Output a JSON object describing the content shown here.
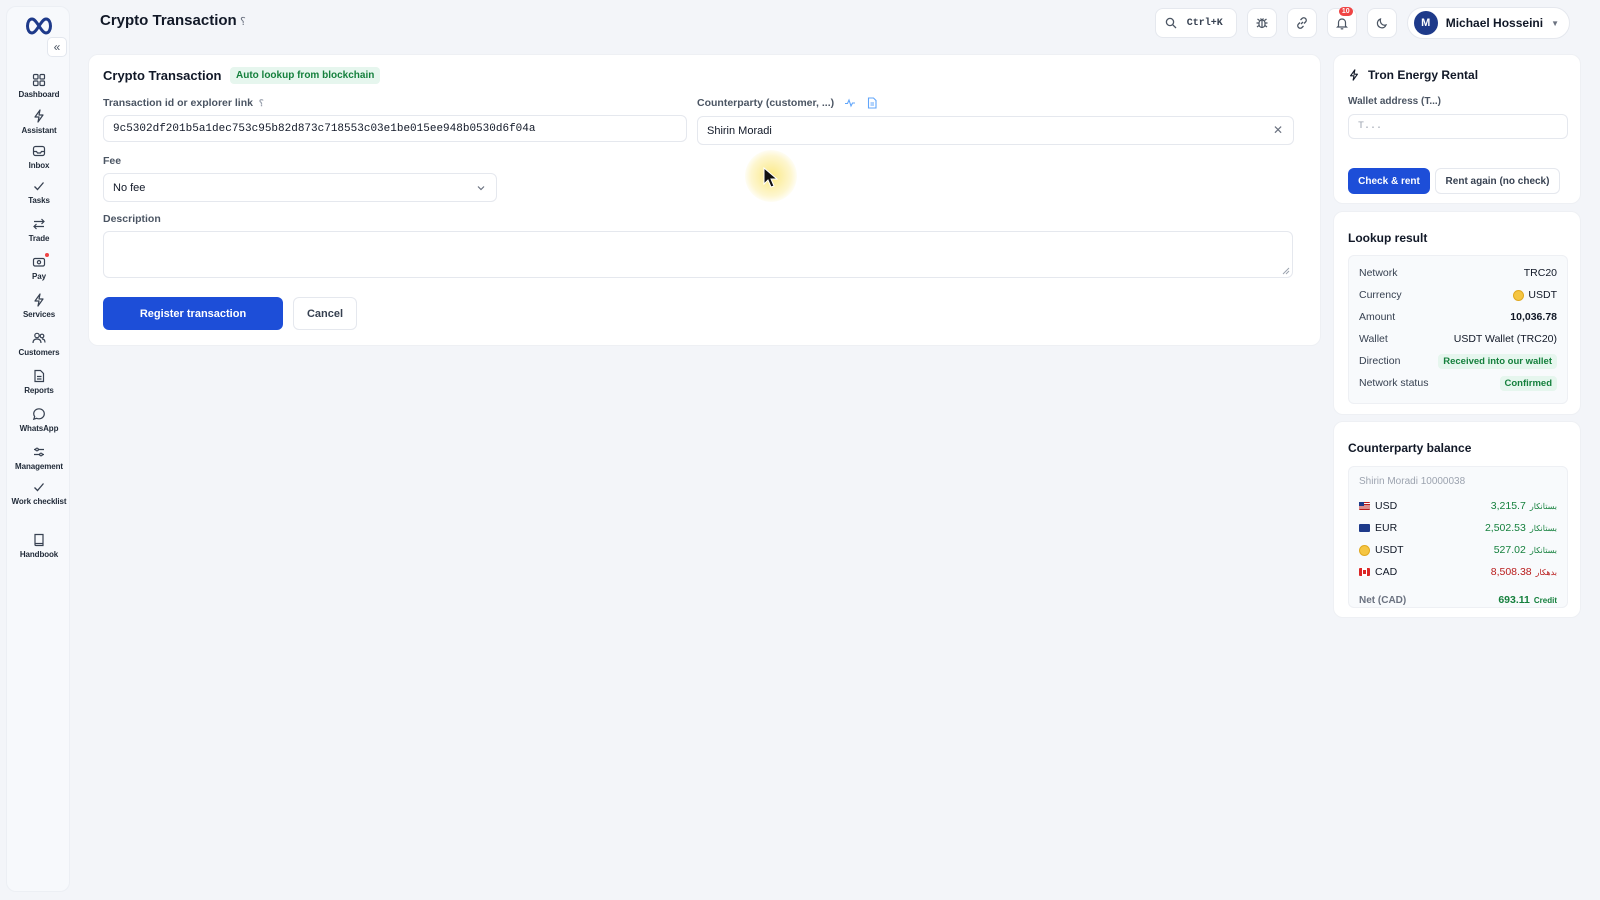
{
  "header": {
    "page_title": "Crypto Transaction",
    "help_glyph": "؟",
    "search_shortcut": "Ctrl+K",
    "notification_count": "10",
    "user": {
      "initial": "M",
      "name": "Michael Hosseini"
    }
  },
  "sidebar": {
    "items": [
      {
        "label": "Dashboard",
        "icon": "dashboard-icon"
      },
      {
        "label": "Assistant",
        "icon": "bolt-icon"
      },
      {
        "label": "Inbox",
        "icon": "inbox-icon"
      },
      {
        "label": "Tasks",
        "icon": "check-icon"
      },
      {
        "label": "Trade",
        "icon": "swap-icon"
      },
      {
        "label": "Pay",
        "icon": "wallet-icon"
      },
      {
        "label": "Services",
        "icon": "bolt-icon"
      },
      {
        "label": "Customers",
        "icon": "users-icon"
      },
      {
        "label": "Reports",
        "icon": "file-icon"
      },
      {
        "label": "WhatsApp",
        "icon": "chat-icon"
      },
      {
        "label": "Management",
        "icon": "sliders-icon"
      },
      {
        "label": "Work checklist",
        "icon": "check-icon"
      },
      {
        "label": "Handbook",
        "icon": "book-icon"
      }
    ]
  },
  "form": {
    "title": "Crypto Transaction",
    "chip": "Auto lookup from blockchain",
    "txid_label": "Transaction id or explorer link",
    "txid_help": "؟",
    "txid_value": "9c5302df201b5a1dec753c95b82d873c718553c03e1be015ee948b0530d6f04a",
    "counterparty_label": "Counterparty (customer, ...)",
    "counterparty_value": "Shirin Moradi",
    "fee_label": "Fee",
    "fee_value": "No fee",
    "description_label": "Description",
    "description_value": "",
    "submit_label": "Register transaction",
    "cancel_label": "Cancel"
  },
  "tron": {
    "title": "Tron Energy Rental",
    "wallet_label": "Wallet address (T...)",
    "wallet_placeholder": "T...",
    "check_label": "Check & rent",
    "rent_again_label": "Rent again (no check)"
  },
  "lookup": {
    "title": "Lookup result",
    "rows": [
      {
        "key": "Network",
        "value": "TRC20"
      },
      {
        "key": "Currency",
        "value": "USDT"
      },
      {
        "key": "Amount",
        "value": "10,036.78"
      },
      {
        "key": "Wallet",
        "value": "USDT Wallet (TRC20)"
      },
      {
        "key": "Direction",
        "value": "Received into our wallet"
      },
      {
        "key": "Network status",
        "value": "Confirmed"
      }
    ]
  },
  "balance": {
    "title": "Counterparty balance",
    "customer": "Shirin Moradi 10000038",
    "rows": [
      {
        "currency": "USD",
        "amount": "3,215.7",
        "tag": "بستانکار"
      },
      {
        "currency": "EUR",
        "amount": "2,502.53",
        "tag": "بستانکار"
      },
      {
        "currency": "USDT",
        "amount": "527.02",
        "tag": "بستانکار"
      },
      {
        "currency": "CAD",
        "amount": "8,508.38",
        "tag": "بدهکار"
      }
    ],
    "net_label": "Net (CAD)",
    "net_value": "693.11",
    "net_tag": "Credit"
  },
  "colors": {
    "primary": "#1d4ed8",
    "success": "#15803d",
    "danger": "#b91c1c",
    "badge": "#ef4444"
  }
}
